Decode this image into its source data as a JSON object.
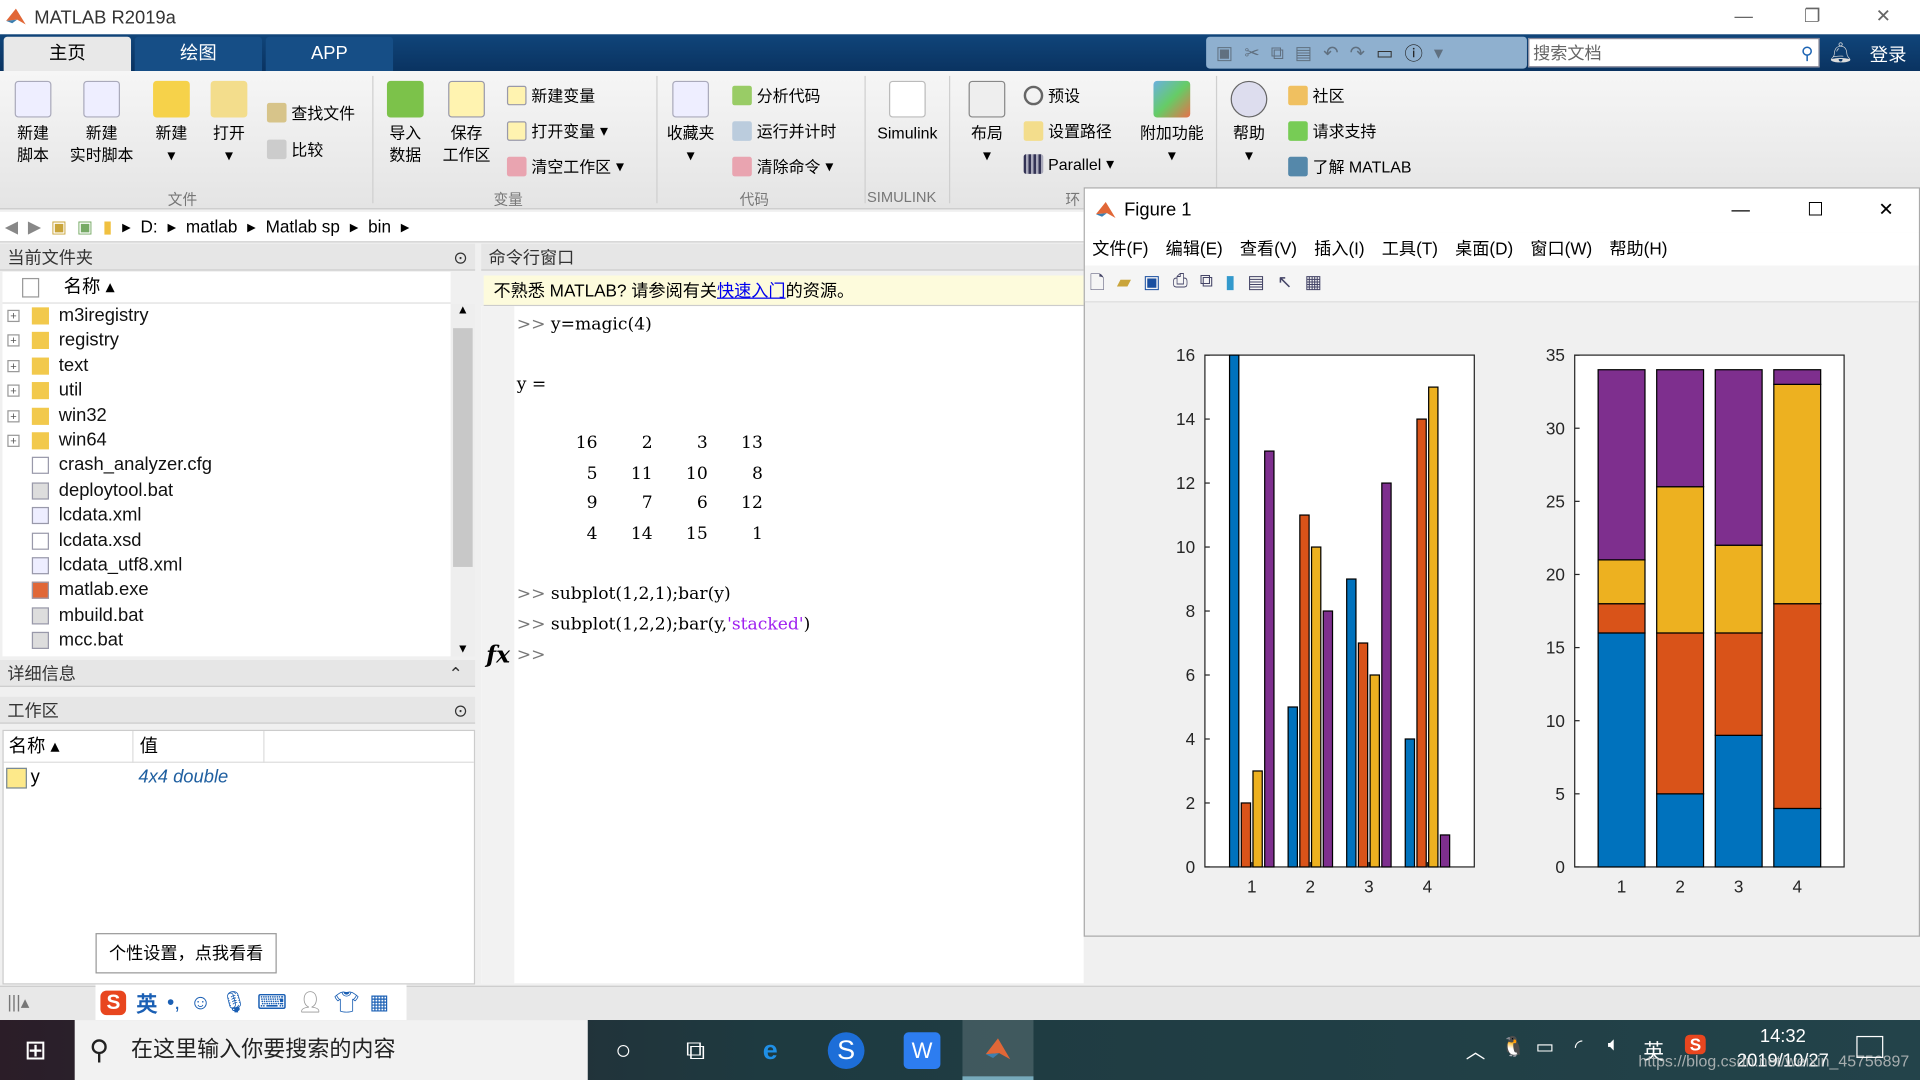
{
  "app": {
    "title": "MATLAB R2019a"
  },
  "tabs": [
    {
      "label": "主页",
      "active": true
    },
    {
      "label": "绘图"
    },
    {
      "label": "APP"
    }
  ],
  "search": {
    "placeholder": "搜索文档"
  },
  "login": "登录",
  "ribbon": {
    "file": {
      "new_script": [
        "新建",
        "脚本"
      ],
      "new_live": [
        "新建",
        "实时脚本"
      ],
      "new": "新建",
      "open": "打开",
      "find_files": "查找文件",
      "compare": "比较",
      "section": "文件"
    },
    "variable": {
      "import": [
        "导入",
        "数据"
      ],
      "save": [
        "保存",
        "工作区"
      ],
      "new_var": "新建变量",
      "open_var": "打开变量",
      "clear_ws": "清空工作区",
      "section": "变量"
    },
    "code": {
      "favorites": "收藏夹",
      "analyze": "分析代码",
      "run_time": "运行并计时",
      "clear_cmd": "清除命令",
      "section": "代码"
    },
    "simulink": {
      "label": "Simulink",
      "section": "SIMULINK"
    },
    "env": {
      "layout": "布局",
      "prefs": "预设",
      "set_path": "设置路径",
      "parallel": "Parallel",
      "addons": "附加功能",
      "section": "环"
    },
    "resources": {
      "help": "帮助",
      "community": "社区",
      "support": "请求支持",
      "learn": "了解 MATLAB"
    }
  },
  "address": {
    "path": [
      "D:",
      "matlab",
      "Matlab sp",
      "bin"
    ]
  },
  "current_folder": {
    "title": "当前文件夹",
    "col_name": "名称 ▴",
    "items": [
      {
        "name": "m3iregistry",
        "type": "folder"
      },
      {
        "name": "registry",
        "type": "folder"
      },
      {
        "name": "text",
        "type": "folder"
      },
      {
        "name": "util",
        "type": "folder"
      },
      {
        "name": "win32",
        "type": "folder"
      },
      {
        "name": "win64",
        "type": "folder"
      },
      {
        "name": "crash_analyzer.cfg",
        "type": "file"
      },
      {
        "name": "deploytool.bat",
        "type": "bat"
      },
      {
        "name": "lcdata.xml",
        "type": "xml"
      },
      {
        "name": "lcdata.xsd",
        "type": "file"
      },
      {
        "name": "lcdata_utf8.xml",
        "type": "xml"
      },
      {
        "name": "matlab.exe",
        "type": "exe"
      },
      {
        "name": "mbuild.bat",
        "type": "bat"
      },
      {
        "name": "mcc.bat",
        "type": "bat"
      }
    ]
  },
  "details": {
    "title": "详细信息"
  },
  "workspace": {
    "title": "工作区",
    "col_name": "名称 ▴",
    "col_value": "值",
    "rows": [
      {
        "name": "y",
        "value": "4x4 double"
      }
    ]
  },
  "command_window": {
    "title": "命令行窗口",
    "banner_pre": "不熟悉 MATLAB? 请参阅有关",
    "banner_link": "快速入门",
    "banner_post": "的资源。",
    "prompt": ">>",
    "cmd1": "y=magic(4)",
    "y_eq": "y =",
    "matrix": [
      [
        "16",
        "2",
        "3",
        "13"
      ],
      [
        "5",
        "11",
        "10",
        "8"
      ],
      [
        "9",
        "7",
        "6",
        "12"
      ],
      [
        "4",
        "14",
        "15",
        "1"
      ]
    ],
    "cmd2": "subplot(1,2,1);bar(y)",
    "cmd3_pre": "subplot(1,2,2);bar(y,",
    "cmd3_str": "'stacked'",
    "cmd3_post": ")",
    "fx": "fx"
  },
  "figure": {
    "title": "Figure 1",
    "menu": [
      "文件(F)",
      "编辑(E)",
      "查看(V)",
      "插入(I)",
      "工具(T)",
      "桌面(D)",
      "窗口(W)",
      "帮助(H)"
    ]
  },
  "chart_data": [
    {
      "type": "bar",
      "categories": [
        "1",
        "2",
        "3",
        "4"
      ],
      "ylim": [
        0,
        16
      ],
      "yticks": [
        0,
        2,
        4,
        6,
        8,
        10,
        12,
        14,
        16
      ],
      "series": [
        {
          "values": [
            16,
            5,
            9,
            4
          ]
        },
        {
          "values": [
            2,
            11,
            7,
            14
          ]
        },
        {
          "values": [
            3,
            10,
            6,
            15
          ]
        },
        {
          "values": [
            13,
            8,
            12,
            1
          ]
        }
      ],
      "colors": [
        "#0072bd",
        "#d95319",
        "#edb120",
        "#7e2f8e"
      ]
    },
    {
      "type": "bar",
      "stacked": true,
      "categories": [
        "1",
        "2",
        "3",
        "4"
      ],
      "ylim": [
        0,
        35
      ],
      "yticks": [
        0,
        5,
        10,
        15,
        20,
        25,
        30,
        35
      ],
      "series": [
        {
          "values": [
            16,
            5,
            9,
            4
          ]
        },
        {
          "values": [
            2,
            11,
            7,
            14
          ]
        },
        {
          "values": [
            3,
            10,
            6,
            15
          ]
        },
        {
          "values": [
            13,
            8,
            12,
            1
          ]
        }
      ],
      "colors": [
        "#0072bd",
        "#d95319",
        "#edb120",
        "#7e2f8e"
      ]
    }
  ],
  "tooltip": "个性设置，点我看看",
  "ime": {
    "lang": "英"
  },
  "taskbar": {
    "search_placeholder": "在这里输入你要搜索的内容",
    "tray_lang": "英",
    "time": "14:32",
    "date": "2019/10/27",
    "watermark": "https://blog.csdn.net/weixin_45756897"
  }
}
